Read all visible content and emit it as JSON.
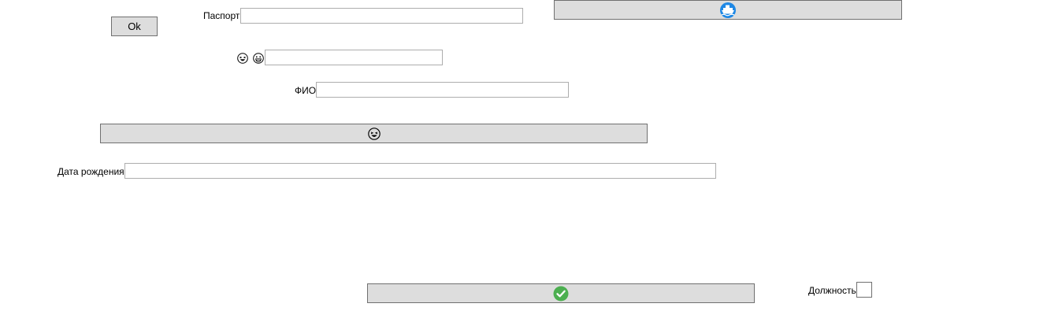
{
  "form": {
    "ok_label": "Ok",
    "passport_label": "Паспорт",
    "passport_value": "",
    "emoji_row_value": "",
    "fio_label": "ФИО",
    "fio_value": "",
    "birthdate_label": "Дата рождения",
    "birthdate_value": "",
    "position_label": "Должность",
    "position_checked": false
  },
  "icons": {
    "top_button_icon": "ship-icon",
    "middle_button_icon": "laughing-face-icon",
    "confirm_button_icon": "check-circle-icon",
    "emoji_label_icons": [
      "laughing-face-icon",
      "grinning-face-icon"
    ]
  },
  "colors": {
    "button_bg": "#dddddd",
    "button_border": "#707070",
    "field_border": "#adadad",
    "ship_icon": "#1e88e5",
    "check_icon": "#4caf50"
  }
}
